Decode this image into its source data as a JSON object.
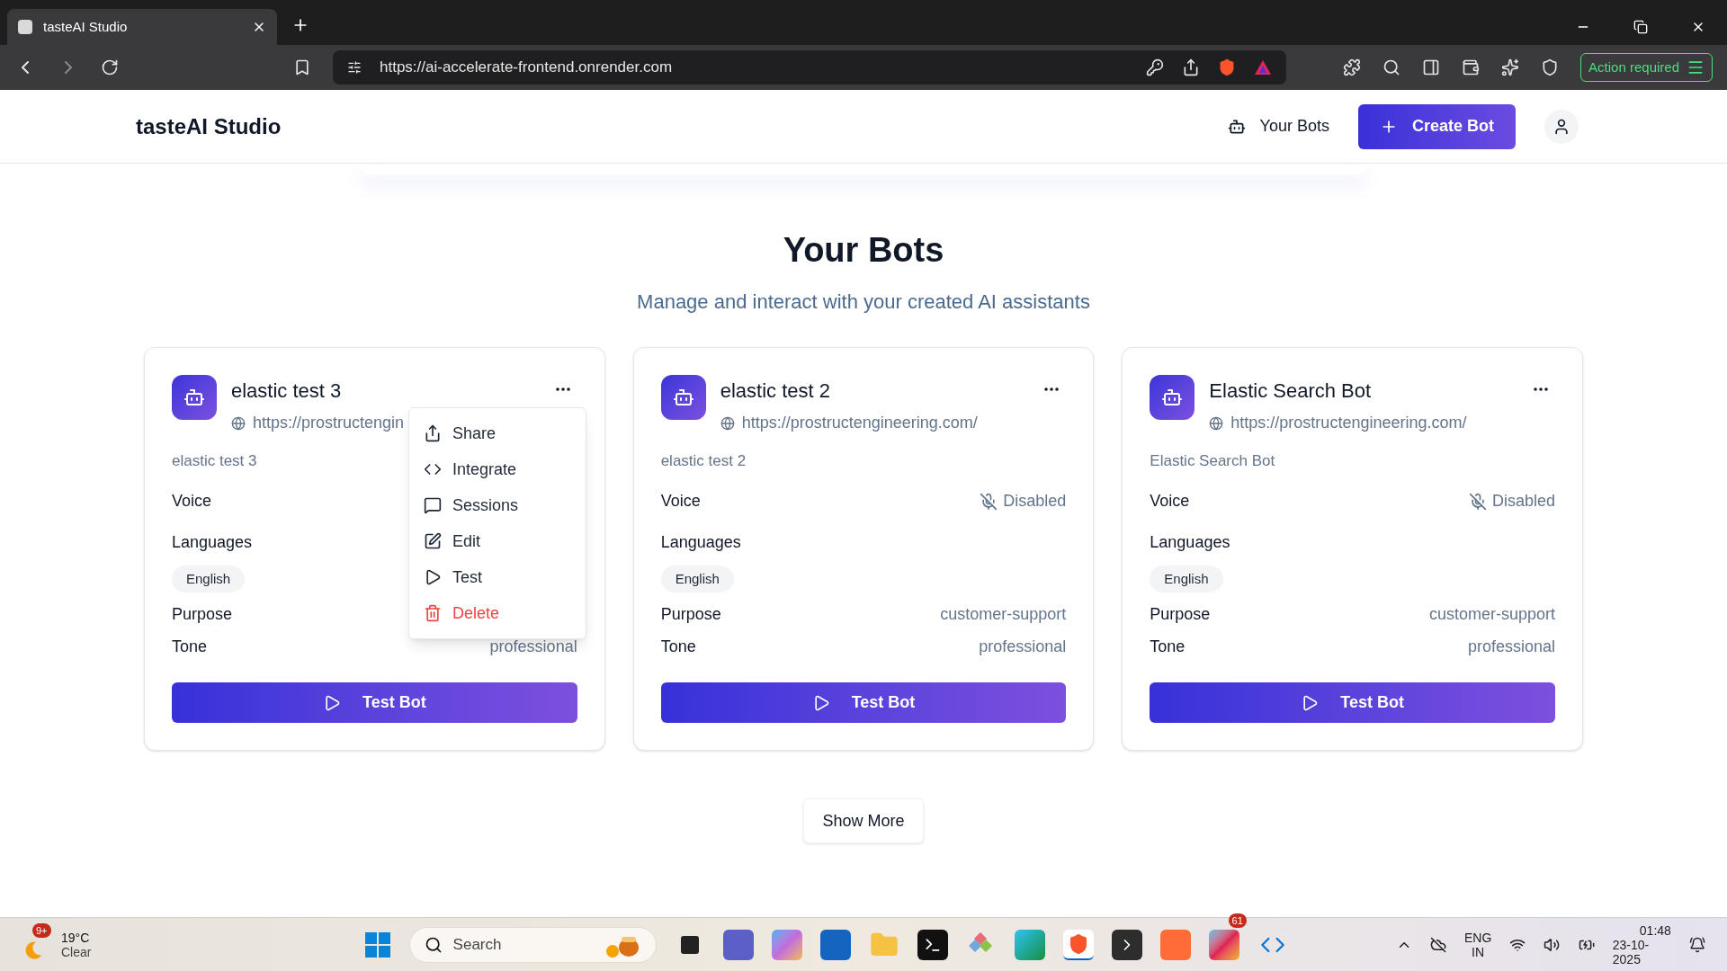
{
  "browser": {
    "tab_title": "tasteAI Studio",
    "url": "https://ai-accelerate-frontend.onrender.com",
    "action_button": "Action required"
  },
  "header": {
    "brand": "tasteAI Studio",
    "nav": [
      {
        "label": "Your Bots",
        "kind": "link"
      },
      {
        "label": "Create Bot",
        "kind": "primary"
      }
    ]
  },
  "page": {
    "title": "Your Bots",
    "subtitle": "Manage and interact with your created AI assistants"
  },
  "bots": [
    {
      "name": "elastic test 3",
      "url": "https://prostructengin",
      "description": "elastic test 3",
      "fields": [
        {
          "label": "Voice",
          "kind": "voice"
        },
        {
          "label": "Languages",
          "kind": "tags",
          "tags": [
            "English"
          ]
        },
        {
          "label": "Purpose",
          "kind": "text"
        },
        {
          "label": "Tone",
          "kind": "text",
          "value": "professional"
        }
      ],
      "button": "Test Bot",
      "menu": [
        {
          "label": "Share",
          "kind": "share"
        },
        {
          "label": "Integrate",
          "kind": "code"
        },
        {
          "label": "Sessions",
          "kind": "chat"
        },
        {
          "label": "Edit",
          "kind": "edit"
        },
        {
          "label": "Test",
          "kind": "play"
        },
        {
          "label": "Delete",
          "kind": "delete"
        }
      ]
    },
    {
      "name": "elastic test 2",
      "url": "https://prostructengineering.com/",
      "description": "elastic test 2",
      "fields": [
        {
          "label": "Voice",
          "kind": "voice",
          "value": "Disabled"
        },
        {
          "label": "Languages",
          "kind": "tags",
          "tags": [
            "English"
          ]
        },
        {
          "label": "Purpose",
          "kind": "text",
          "value": "customer-support"
        },
        {
          "label": "Tone",
          "kind": "text",
          "value": "professional"
        }
      ],
      "button": "Test Bot"
    },
    {
      "name": "Elastic Search Bot",
      "url": "https://prostructengineering.com/",
      "description": "Elastic Search Bot",
      "fields": [
        {
          "label": "Voice",
          "kind": "voice",
          "value": "Disabled"
        },
        {
          "label": "Languages",
          "kind": "tags",
          "tags": [
            "English"
          ]
        },
        {
          "label": "Purpose",
          "kind": "text",
          "value": "customer-support"
        },
        {
          "label": "Tone",
          "kind": "text",
          "value": "professional"
        }
      ],
      "button": "Test Bot"
    }
  ],
  "show_more": "Show More",
  "taskbar": {
    "weather_badge": "9+",
    "temperature": "19°C",
    "condition": "Clear",
    "search_placeholder": "Search",
    "slack_badge": "61",
    "lang_top": "ENG",
    "lang_bottom": "IN",
    "time": "01:48",
    "date": "23-10-2025"
  }
}
